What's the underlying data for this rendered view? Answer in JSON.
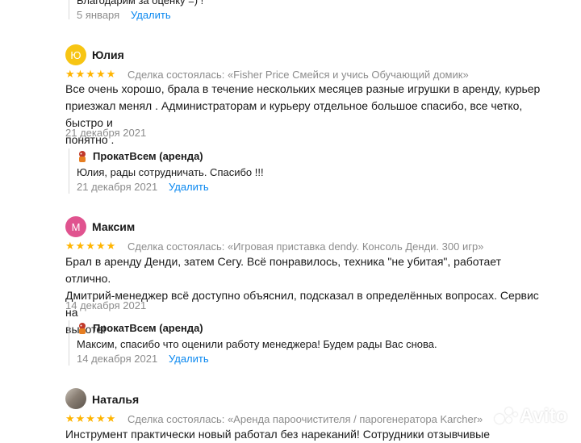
{
  "top_reply": {
    "text": "Благодарим за оценку =) !",
    "date": "5 января",
    "delete_label": "Удалить"
  },
  "reviews": [
    {
      "initial": "Ю",
      "avatar_color": "#f7c513",
      "name": "Юлия",
      "stars": "★★★★★",
      "deal": "Сделка состоялась: «Fisher Price Смейся и учись Обучающий домик»",
      "text_lines": [
        "Все очень хорошо, брала в течение нескольких месяцев разные игрушки в аренду, курьер",
        "приезжал менял . Администраторам и курьеру отдельное большое спасибо, все четко, быстро и",
        "понятно ."
      ],
      "date": "21 декабря 2021",
      "reply": {
        "shop": "ПрокатВсем (аренда)",
        "text": "Юлия, рады сотрудничать. Спасибо !!!",
        "date": "21 декабря 2021",
        "delete_label": "Удалить"
      }
    },
    {
      "initial": "М",
      "avatar_color": "#e0538f",
      "name": "Максим",
      "stars": "★★★★★",
      "deal": "Сделка состоялась: «Игровая приставка dendy. Консоль Денди. 300 игр»",
      "text_lines": [
        "Брал в аренду Денди, затем Сегу. Всё понравилось, техника \"не убитая\", работает отлично.",
        "Дмитрий-менеджер всё доступно объяснил, подсказал в определённых вопросах. Сервис на",
        "высоте!"
      ],
      "date": "14 декабря 2021",
      "reply": {
        "shop": "ПрокатВсем (аренда)",
        "text": "Максим, спасибо что оценили работу менеджера! Будем рады Вас снова.",
        "date": "14 декабря 2021",
        "delete_label": "Удалить"
      }
    },
    {
      "name": "Наталья",
      "stars": "★★★★★",
      "deal": "Сделка состоялась: «Аренда пароочистителя / парогенератора Karcher»",
      "text_lines": [
        "Инструмент практически новый работал без нареканий! Сотрудники отзывчивые"
      ]
    }
  ],
  "watermark": "Avito",
  "colors": {
    "star": "#ffb400",
    "link": "#0a88f0",
    "muted": "#8c8c8c"
  }
}
